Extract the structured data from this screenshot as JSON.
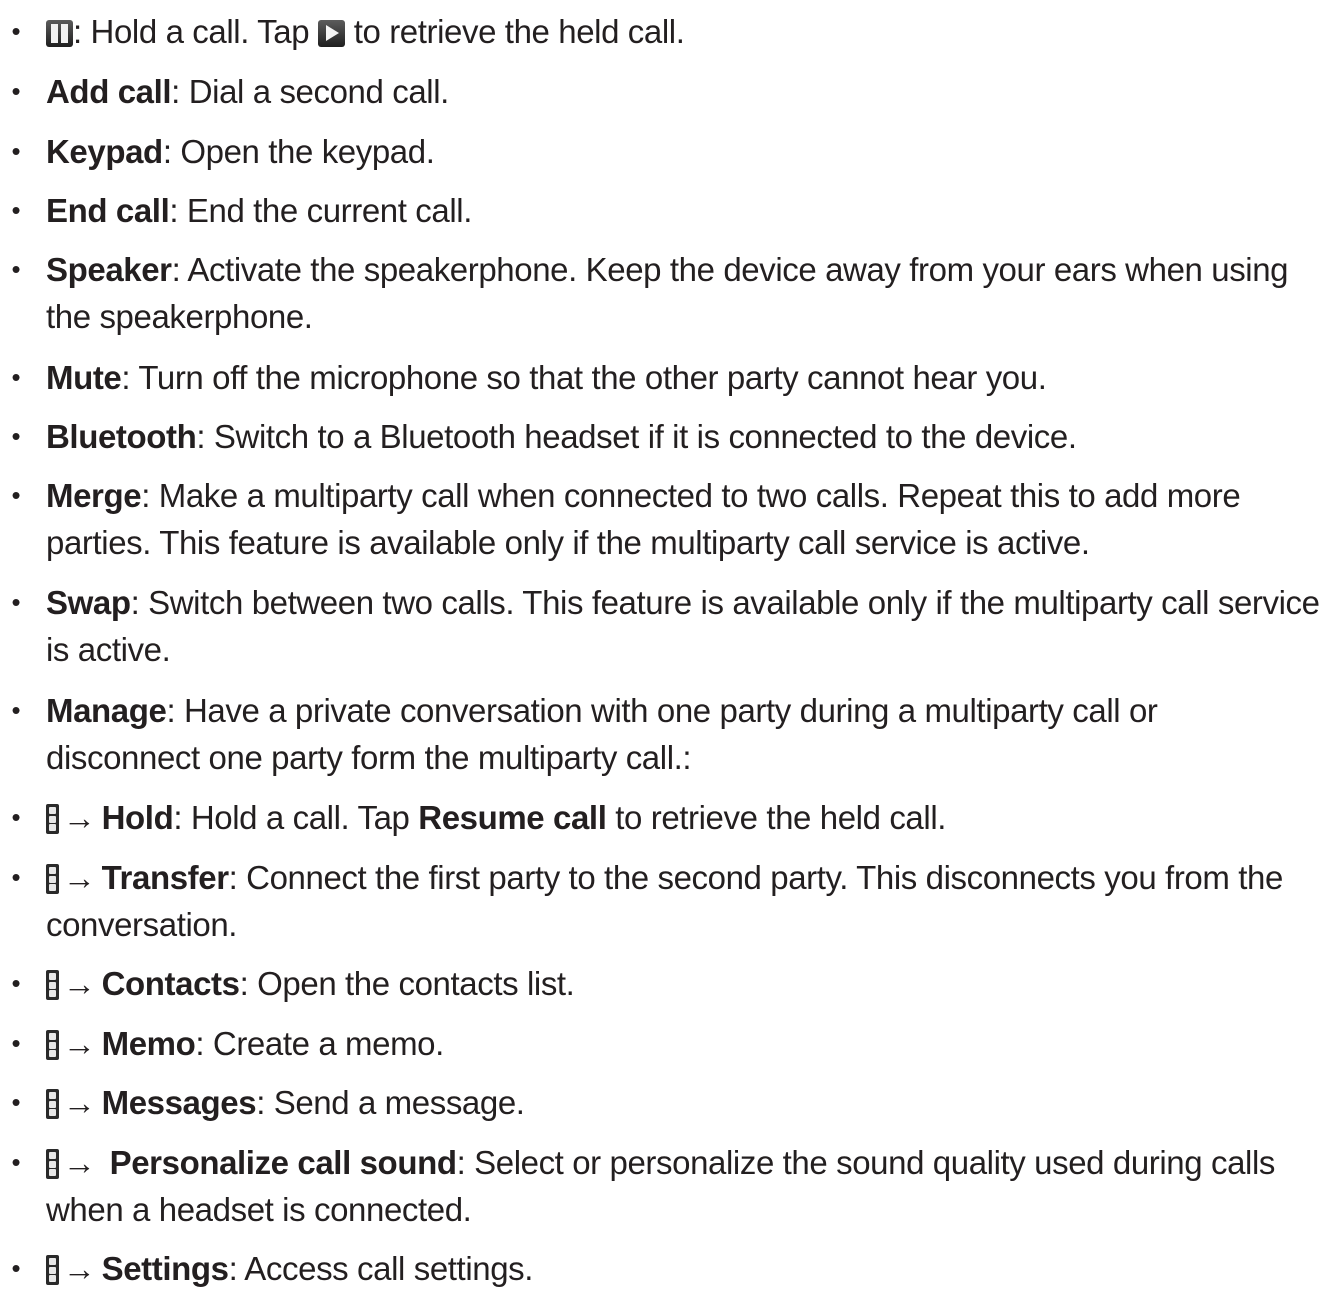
{
  "bullet_char": "•",
  "arrow": "→",
  "items": [
    {
      "pre": ": Hold a call. Tap ",
      "post": " to retrieve the held call."
    },
    {
      "term": "Add call",
      "desc": ": Dial a second call."
    },
    {
      "term": "Keypad",
      "desc": ": Open the keypad."
    },
    {
      "term": "End call",
      "desc": ": End the current call."
    },
    {
      "term": "Speaker",
      "desc": ": Activate the speakerphone. Keep the device away from your ears when using",
      "desc2": "the speakerphone."
    },
    {
      "term": "Mute",
      "desc": ": Turn off the microphone so that the other party cannot hear you."
    },
    {
      "term": "Bluetooth",
      "desc": ": Switch to a Bluetooth headset if it is connected to the device."
    },
    {
      "term": "Merge",
      "desc": ": Make a multiparty call when connected to two calls. Repeat this to add more",
      "desc2": "parties. This feature is available only if the multiparty call service is active."
    },
    {
      "term": "Swap",
      "desc": ": Switch between two calls. This feature is available only if the multiparty call service",
      "desc2": "is active."
    },
    {
      "term": "Manage",
      "desc": ": Have a private conversation with one party during a multiparty call or",
      "desc2": "disconnect one party form the multiparty call.:"
    },
    {
      "term": "Hold",
      "desc": ": Hold a call. Tap ",
      "term2": "Resume call",
      "desc_end": " to retrieve the held call."
    },
    {
      "term": "Transfer",
      "desc": ": Connect the first party to the second party. This disconnects you from the",
      "desc2": "conversation."
    },
    {
      "term": "Contacts",
      "desc": ": Open the contacts list."
    },
    {
      "term": "Memo",
      "desc": ": Create a memo."
    },
    {
      "term": "Messages",
      "desc": ": Send a message."
    },
    {
      "term": "Personalize call sound",
      "desc": ": Select or personalize the sound quality used during calls",
      "desc2": "when a headset is connected."
    },
    {
      "term": "Settings",
      "desc": ": Access call settings."
    }
  ]
}
